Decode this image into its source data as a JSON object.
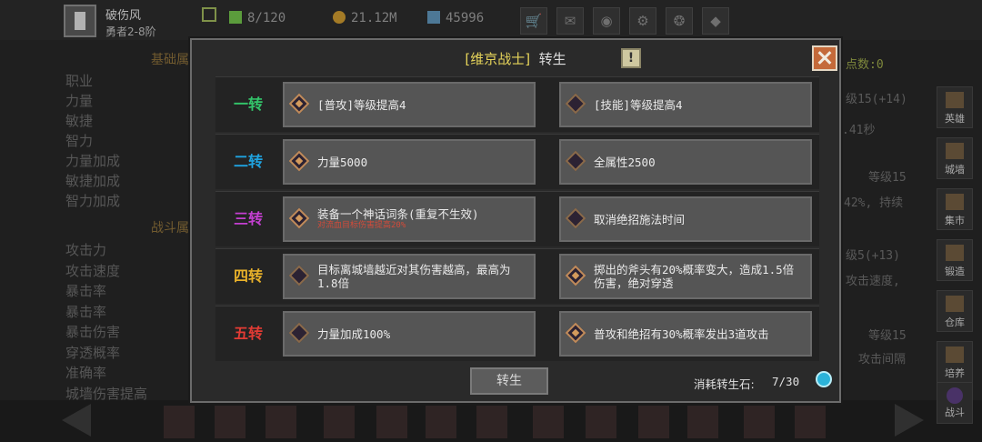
{
  "player": {
    "name": "破伤风",
    "rank": "勇者2-8阶"
  },
  "resources": {
    "stamina": "8/120",
    "gold": "21.12M",
    "gems": "45996"
  },
  "background": {
    "section_basic": "基础属",
    "basic_stats": [
      "职业",
      "力量",
      "敏捷",
      "智力",
      "力量加成",
      "敏捷加成",
      "智力加成"
    ],
    "section_battle": "战斗属",
    "battle_stats": [
      "攻击力",
      "攻击速度",
      "暴击率",
      "暴击率",
      "暴击伤害",
      "穿透概率",
      "准确率",
      "城墙伤害提高"
    ],
    "skill_points": "点数:0",
    "right_lines": [
      "级15(+14)",
      ".41秒",
      "等级15",
      "42%, 持续",
      "级5(+13)",
      "攻击速度,",
      "等级15",
      "攻击间隔"
    ],
    "side_buttons": [
      "英雄",
      "城墙",
      "集市",
      "锻造",
      "仓库",
      "培养",
      "战斗"
    ]
  },
  "modal": {
    "title_bracket_open": "[",
    "class_name": "维京战士",
    "title_bracket_close": "]",
    "title": "转生",
    "info_label": "!",
    "tiers": [
      {
        "label": "一转",
        "color": "#33c46a",
        "left": {
          "text": "[普攻]等级提高4",
          "sub": "",
          "active": true
        },
        "right": {
          "text": "[技能]等级提高4",
          "sub": "",
          "active": false
        }
      },
      {
        "label": "二转",
        "color": "#1fa3e0",
        "left": {
          "text": "力量5000",
          "sub": "",
          "active": true
        },
        "right": {
          "text": "全属性2500",
          "sub": "",
          "active": false
        }
      },
      {
        "label": "三转",
        "color": "#c43fd1",
        "left": {
          "text": "装备一个神话词条(重复不生效)",
          "sub": "对流血目标伤害提高20%",
          "active": true
        },
        "right": {
          "text": "取消绝招施法时间",
          "sub": "",
          "active": false
        }
      },
      {
        "label": "四转",
        "color": "#e8b12a",
        "left": {
          "text": "目标离城墙越近对其伤害越高，最高为1.8倍",
          "sub": "",
          "active": false
        },
        "right": {
          "text": "掷出的斧头有20%概率变大，造成1.5倍伤害，绝对穿透",
          "sub": "",
          "active": true
        }
      },
      {
        "label": "五转",
        "color": "#e23b34",
        "left": {
          "text": "力量加成100%",
          "sub": "",
          "active": false
        },
        "right": {
          "text": "普攻和绝招有30%概率发出3道攻击",
          "sub": "",
          "active": true
        }
      }
    ],
    "rebirth_button": "转生",
    "cost_label": "消耗转生石:",
    "cost_value": "7/30"
  },
  "colors": {
    "accent_gold": "#e6d45a",
    "close_orange": "#c46a3a"
  }
}
